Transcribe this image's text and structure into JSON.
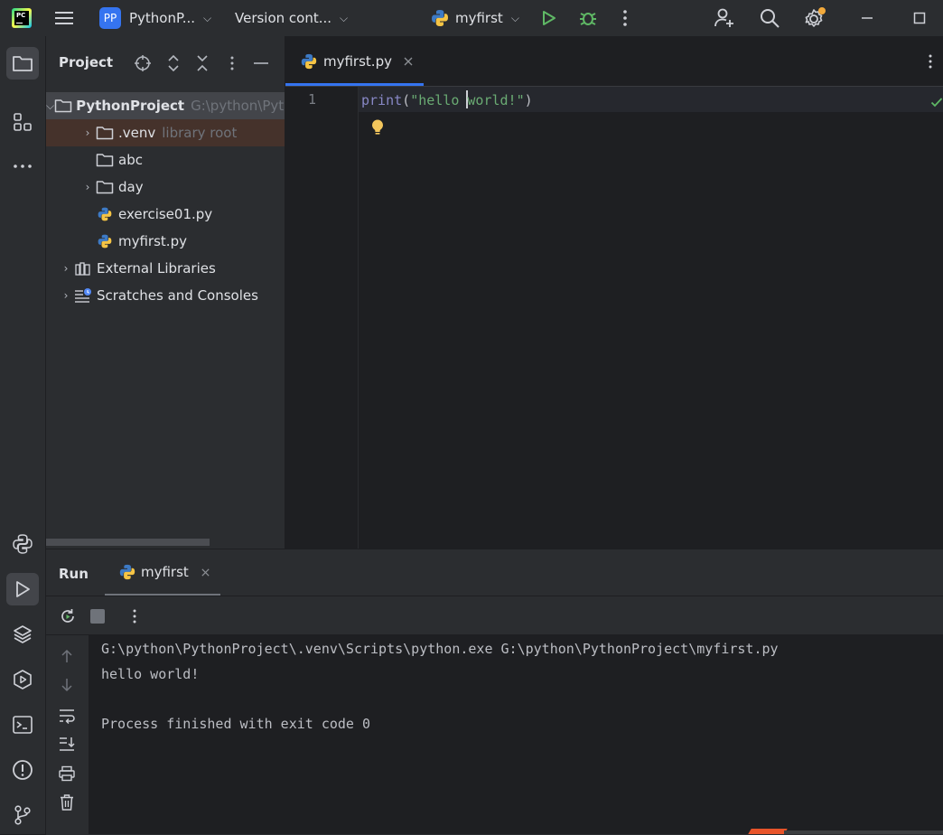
{
  "titlebar": {
    "app_icon": "pycharm-logo",
    "project_badge": "PP",
    "project_name": "PythonP...",
    "vcs_label": "Version cont...",
    "run_config": "myfirst",
    "icons": [
      "hamburger-menu-icon",
      "run-icon",
      "debug-icon",
      "more-vertical-icon",
      "add-user-icon",
      "search-icon",
      "settings-icon",
      "minimize-icon",
      "maximize-icon"
    ],
    "run_color": "#5fb865",
    "settings_badge_color": "#f2a93b"
  },
  "left_toolbar": {
    "top_icons": [
      "folder-icon",
      "structure-icon",
      "more-horizontal-icon"
    ],
    "bottom_icons": [
      "python-packages-icon",
      "run-panel-icon",
      "layers-icon",
      "services-icon",
      "terminal-icon",
      "problems-icon",
      "git-icon"
    ]
  },
  "project_panel": {
    "title": "Project",
    "tree": [
      {
        "label": "PythonProject",
        "hint": "G:\\python\\PythonProject",
        "type": "folder",
        "expanded": true,
        "bold": true
      },
      {
        "label": ".venv",
        "hint": "library root",
        "type": "folder",
        "expanded": false
      },
      {
        "label": "abc",
        "hint": "",
        "type": "folder"
      },
      {
        "label": "day",
        "hint": "",
        "type": "folder",
        "expanded": false
      },
      {
        "label": "exercise01.py",
        "hint": "",
        "type": "python-file"
      },
      {
        "label": "myfirst.py",
        "hint": "",
        "type": "python-file"
      },
      {
        "label": "External Libraries",
        "hint": "",
        "type": "libraries",
        "expanded": false
      },
      {
        "label": "Scratches and Consoles",
        "hint": "",
        "type": "scratches",
        "expanded": false
      }
    ]
  },
  "editor": {
    "tab_label": "myfirst.py",
    "line_number": "1",
    "code": {
      "func": "print",
      "open": "(",
      "str_before_caret": "\"hello ",
      "str_after_caret": "world!\"",
      "close": ")"
    },
    "inspection_status": "ok",
    "accent_color": "#3574f0"
  },
  "run_panel": {
    "title": "Run",
    "tab_label": "myfirst",
    "console": [
      "G:\\python\\PythonProject\\.venv\\Scripts\\python.exe G:\\python\\PythonProject\\myfirst.py",
      "hello world!",
      "",
      "Process finished with exit code 0"
    ],
    "toolbar_icons": [
      "rerun-icon",
      "stop-icon",
      "more-vertical-icon"
    ],
    "side_icons": [
      "scroll-up-icon",
      "scroll-down-icon",
      "soft-wrap-icon",
      "scroll-to-end-icon",
      "print-icon",
      "trash-icon"
    ]
  }
}
